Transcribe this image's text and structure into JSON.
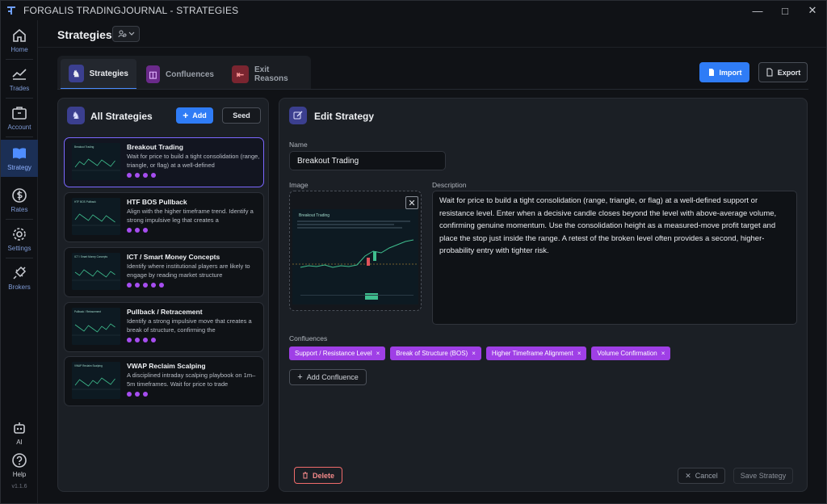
{
  "window": {
    "title": "FORGALIS TRADINGJOURNAL - STRATEGIES",
    "controls": {
      "minimize": "—",
      "maximize": "□",
      "close": "✕"
    }
  },
  "sidebar": {
    "items": [
      {
        "label": "Home",
        "icon": "home-icon"
      },
      {
        "label": "Trades",
        "icon": "chart-line-icon"
      },
      {
        "label": "Account",
        "icon": "briefcase-icon"
      },
      {
        "label": "Strategy",
        "icon": "book-icon",
        "active": true
      },
      {
        "label": "Rates",
        "icon": "dollar-icon"
      },
      {
        "label": "Settings",
        "icon": "gear-icon"
      },
      {
        "label": "Brokers",
        "icon": "plug-icon"
      }
    ],
    "bottom": [
      {
        "label": "AI",
        "icon": "robot-icon"
      },
      {
        "label": "Help",
        "icon": "help-icon"
      }
    ],
    "version": "v1.1.6"
  },
  "header": {
    "title": "Strategies",
    "selector_icon": "user-icon"
  },
  "tabs": [
    {
      "label": "Strategies",
      "active": true
    },
    {
      "label": "Confluences"
    },
    {
      "label": "Exit Reasons"
    }
  ],
  "toolbar": {
    "import_label": "Import",
    "export_label": "Export"
  },
  "list_panel": {
    "title": "All Strategies",
    "add_label": "Add",
    "seed_label": "Seed",
    "strategies": [
      {
        "title": "Breakout Trading",
        "description": "Wait for price to build a tight consolidation (range, triangle, or flag) at a well-defined",
        "rating": 4,
        "active": true,
        "thumb_label": "Breakout Trading"
      },
      {
        "title": "HTF BOS Pullback",
        "description": "Align with the higher timeframe trend. Identify a strong impulsive leg that creates a",
        "rating": 3,
        "thumb_label": "HTF BOS Pullback"
      },
      {
        "title": "ICT / Smart Money Concepts",
        "description": "Identify where institutional players are likely to engage by reading market structure",
        "rating": 5,
        "thumb_label": "ICT / Smart Money Concepts"
      },
      {
        "title": "Pullback / Retracement",
        "description": "Identify a strong impulsive move that creates a break of structure, confirming the",
        "rating": 4,
        "thumb_label": "Pullback / Retracement"
      },
      {
        "title": "VWAP Reclaim Scalping",
        "description": "A disciplined intraday scalping playbook on 1m–5m timeframes. Wait for price to trade",
        "rating": 3,
        "thumb_label": "VWAP Reclaim Scalping"
      }
    ]
  },
  "edit_panel": {
    "title": "Edit Strategy",
    "name_label": "Name",
    "name_value": "Breakout Trading",
    "image_label": "Image",
    "image_title": "Breakout Trading",
    "description_label": "Description",
    "description": "Wait for price to build a tight consolidation (range, triangle, or flag) at a well-defined support or resistance level. Enter when a decisive candle closes beyond the level with above-average volume, confirming genuine momentum. Use the consolidation height as a measured-move profit target and place the stop just inside the range. A retest of the broken level often provides a second, higher-probability entry with tighter risk.",
    "confluences_label": "Confluences",
    "confluences": [
      "Support / Resistance Level",
      "Break of Structure (BOS)",
      "Higher Timeframe Alignment",
      "Volume Confirmation"
    ],
    "chip_remove": "×",
    "add_confluence_label": "Add Confluence",
    "delete_label": "Delete",
    "cancel_label": "Cancel",
    "save_label": "Save Strategy"
  },
  "colors": {
    "accent": "#2f7cf6",
    "chip": "#9f3fe6",
    "dot": "#a64df0",
    "active_border": "#7b67ff",
    "danger": "#f06b6b"
  }
}
